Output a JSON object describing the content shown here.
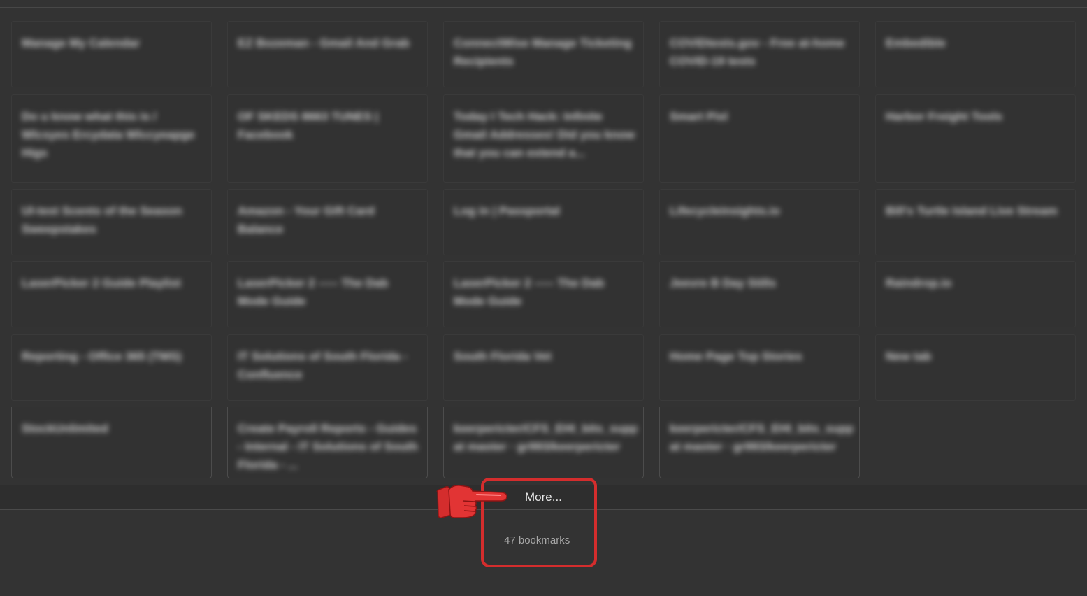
{
  "bookmarks": {
    "tiles": [
      "Manage My Calendar",
      "EZ Bozeman - Gmail And Grab",
      "ConnectWise Manage Ticketing Recipients",
      "COVIDtests.gov - Free at-home COVID-19 tests",
      "Embedible",
      "Do u know what this is / Wlcsyes Ercydata Wlccyeapge Higs",
      "OF SKEDS 8663 TUNES | Facebook",
      "Today I Tech Hack: Infinite Gmail Addresses! Did you know that you can extend a...",
      "Smart Pixl",
      "Harbor Freight Tools",
      "Ul-test Scents of the Season Sweepstakes",
      "Amazon - Your Gift Card Balance",
      "Log in | Passportal",
      "Lifecycleinsights.io",
      "Bill's Turtle Island Live Stream",
      "LaserPicker 2 Guide Playlist",
      "LaserPicker 2 ----- The Dab Mode Guide",
      "LaserPicker 2 ----- The Dab Mode Guide",
      "Jeevre B Day Stills",
      "Raindrop.io",
      "Reporting - Office 365 (TMS)",
      "IT Solutions of South Florida - Confluence",
      "South Florida Vet",
      "Home Page Top Stories",
      "New tab",
      "StockUnlimited",
      "Create Payroll Reports - Guides - Internal - IT Solutions of South Florida - ...",
      "keerpericter/CFS_EHI_bits_supps at master · gr993/keerpericter",
      "keerpericter/CFS_EHI_bits_supps at master · gr993/keerpericter"
    ]
  },
  "footer": {
    "more_label": "More...",
    "count_label": "47 bookmarks"
  },
  "icons": {
    "pointer": "pointing-hand-icon"
  },
  "colors": {
    "background": "#333333",
    "highlight": "#d42d2d"
  }
}
